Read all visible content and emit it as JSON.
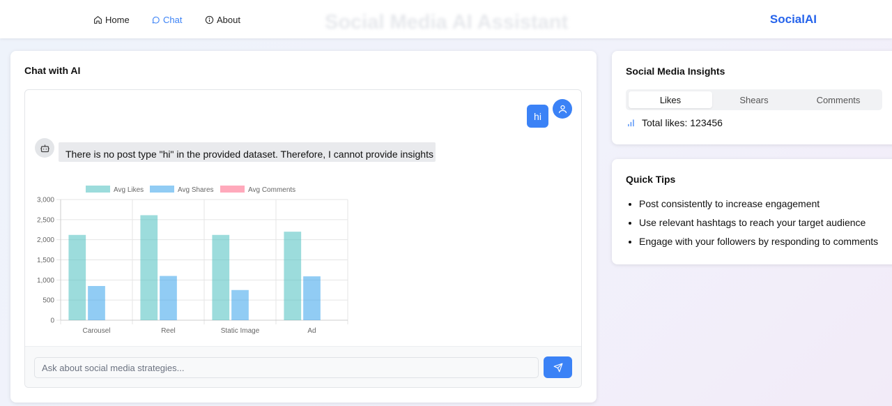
{
  "nav": {
    "items": [
      {
        "label": "Home",
        "icon": "home-icon"
      },
      {
        "label": "Chat",
        "icon": "chat-bubble-icon"
      },
      {
        "label": "About",
        "icon": "info-icon"
      }
    ],
    "page_title": "Social Media AI Assistant",
    "brand": "SocialAI"
  },
  "chat": {
    "title": "Chat with AI",
    "user_message": "hi",
    "bot_message": "There is no post type \"hi\" in the provided dataset. Therefore, I cannot provide insights",
    "input_placeholder": "Ask about social media strategies..."
  },
  "chart_data": {
    "type": "bar",
    "categories": [
      "Carousel",
      "Reel",
      "Static Image",
      "Ad"
    ],
    "series": [
      {
        "name": "Avg Likes",
        "values": [
          2120,
          2610,
          2120,
          2200
        ],
        "color": "#4bc0c0"
      },
      {
        "name": "Avg Shares",
        "values": [
          850,
          1100,
          750,
          1090
        ],
        "color": "#36a2eb"
      },
      {
        "name": "Avg Comments",
        "values": [
          0,
          0,
          0,
          0
        ],
        "color": "#ff6384"
      }
    ],
    "yticks": [
      "0",
      "500",
      "1,000",
      "1,500",
      "2,000",
      "2,500",
      "3,000"
    ],
    "ylim": [
      0,
      3000
    ],
    "grid": true,
    "legend": "top"
  },
  "insights": {
    "title": "Social Media Insights",
    "tabs": [
      "Likes",
      "Shears",
      "Comments"
    ],
    "active_tab": "Likes",
    "total_label": "Total likes: 123456"
  },
  "tips": {
    "title": "Quick Tips",
    "items": [
      "Post consistently to increase engagement",
      "Use relevant hashtags to reach your target audience",
      "Engage with your followers by responding to comments"
    ]
  },
  "colors": {
    "accent": "#3b82f6",
    "brand": "#2563eb"
  }
}
